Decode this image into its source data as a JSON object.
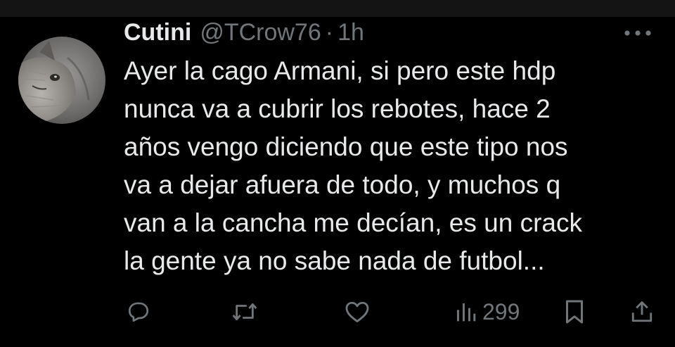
{
  "tweet": {
    "display_name": "Cutini",
    "handle": "@TCrow76",
    "separator": "·",
    "time": "1h",
    "text": "Ayer la cago Armani, si pero este hdp\nnunca va a cubrir los rebotes, hace 2\naños vengo diciendo que este tipo nos\nva a dejar afuera de todo, y muchos q\nvan a la cancha me decían, es un crack\nla gente ya no sabe nada de futbol...",
    "views": "299"
  },
  "icons": {
    "avatar": "cat-photo-avatar",
    "more": "more-horizontal-icon",
    "reply": "reply-icon",
    "retweet": "retweet-icon",
    "like": "like-heart-icon",
    "views": "views-bar-chart-icon",
    "bookmark": "bookmark-icon",
    "share": "share-icon"
  },
  "colors": {
    "background": "#000000",
    "text": "#e7e9ea",
    "secondary": "#71767b"
  }
}
